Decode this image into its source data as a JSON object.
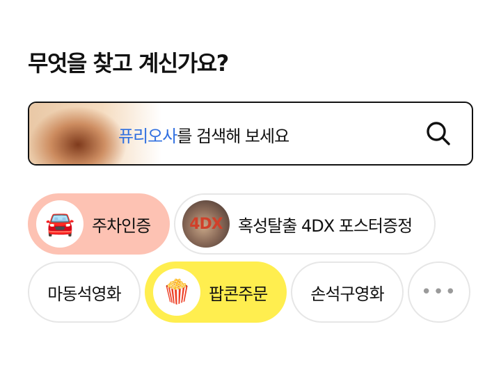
{
  "heading": "무엇을 찾고 계신가요?",
  "search": {
    "highlight": "퓨리오사",
    "rest": "를 검색해 보세요"
  },
  "chips": {
    "parking": {
      "label": "주차인증",
      "icon": "car-icon",
      "emoji": "🚘"
    },
    "promo": {
      "label": "혹성탈출 4DX 포스터증정",
      "icon": "poster-thumbnail",
      "badge": "4DX"
    },
    "madong": {
      "label": "마동석영화"
    },
    "popcorn": {
      "label": "팝콘주문",
      "icon": "popcorn-icon",
      "emoji": "🍿"
    },
    "son": {
      "label": "손석구영화"
    },
    "more": {
      "icon": "more-icon",
      "text": "•••"
    }
  },
  "colors": {
    "parking_bg": "#fdc2b3",
    "popcorn_bg": "#ffee4f",
    "search_highlight": "#2f6fe0"
  }
}
